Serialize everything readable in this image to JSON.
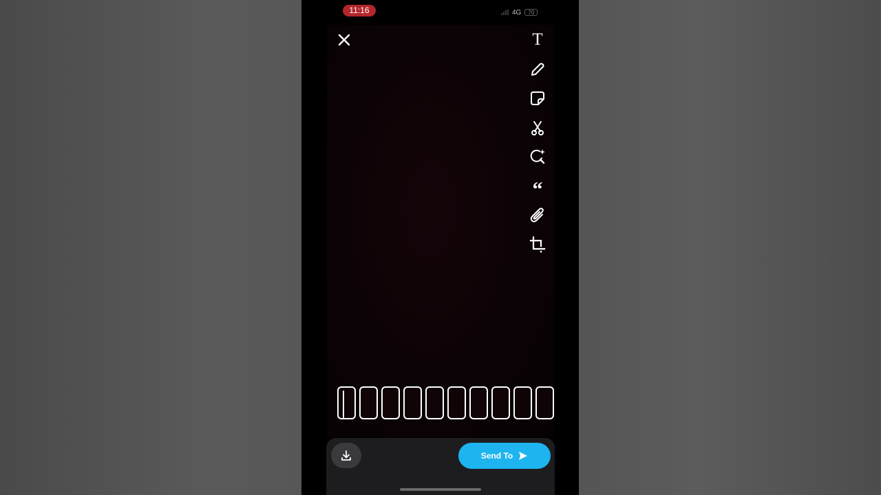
{
  "status_bar": {
    "time": "11:16",
    "network": "4G",
    "battery": "70"
  },
  "icons": {
    "close": "close-icon",
    "tools": [
      "text-icon",
      "pencil-icon",
      "sticker-icon",
      "scissors-icon",
      "lens-icon",
      "quote-icon",
      "paperclip-icon",
      "crop-icon"
    ],
    "save": "download-icon",
    "send": "send-arrow-icon"
  },
  "toolbar": {
    "text_glyph": "T",
    "quote_glyph": "“"
  },
  "timeline": {
    "frame_count": 10
  },
  "bottom": {
    "send_label": "Send To"
  },
  "colors": {
    "recording_pill": "#b3262c",
    "send_button": "#1eb4f0"
  }
}
